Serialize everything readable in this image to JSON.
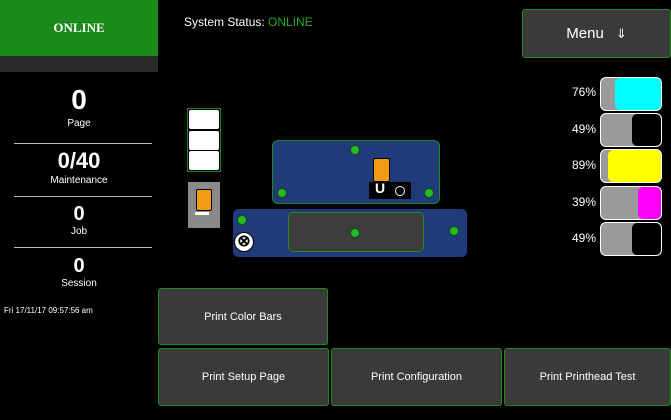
{
  "sidebar": {
    "status_tile": "ONLINE",
    "counters": [
      {
        "value": "0",
        "label": "Page"
      },
      {
        "value": "0/40",
        "label": "Maintenance"
      },
      {
        "value": "0",
        "label": "Job"
      },
      {
        "value": "0",
        "label": "Session"
      }
    ],
    "datetime": "Fri 17/11/17 09:57:56 am"
  },
  "header": {
    "status_prefix": "System Status: ",
    "status_value": "ONLINE",
    "menu_label": "Menu",
    "menu_icon": "⇓"
  },
  "ink_levels": [
    {
      "percent": "76%",
      "fill": 0.76,
      "color": "#00ffff",
      "name": "cyan"
    },
    {
      "percent": "49%",
      "fill": 0.49,
      "color": "#000000",
      "name": "black"
    },
    {
      "percent": "89%",
      "fill": 0.89,
      "color": "#ffff00",
      "name": "yellow"
    },
    {
      "percent": "39%",
      "fill": 0.39,
      "color": "#ff00ff",
      "name": "magenta"
    },
    {
      "percent": "49%",
      "fill": 0.49,
      "color": "#000000",
      "name": "black"
    }
  ],
  "buttons": {
    "print_color_bars": "Print Color Bars",
    "print_setup_page": "Print Setup Page",
    "print_configuration": "Print Configuration",
    "print_printhead_test": "Print Printhead Test"
  },
  "icons": {
    "cancel": "⊗",
    "head_u": "U"
  }
}
